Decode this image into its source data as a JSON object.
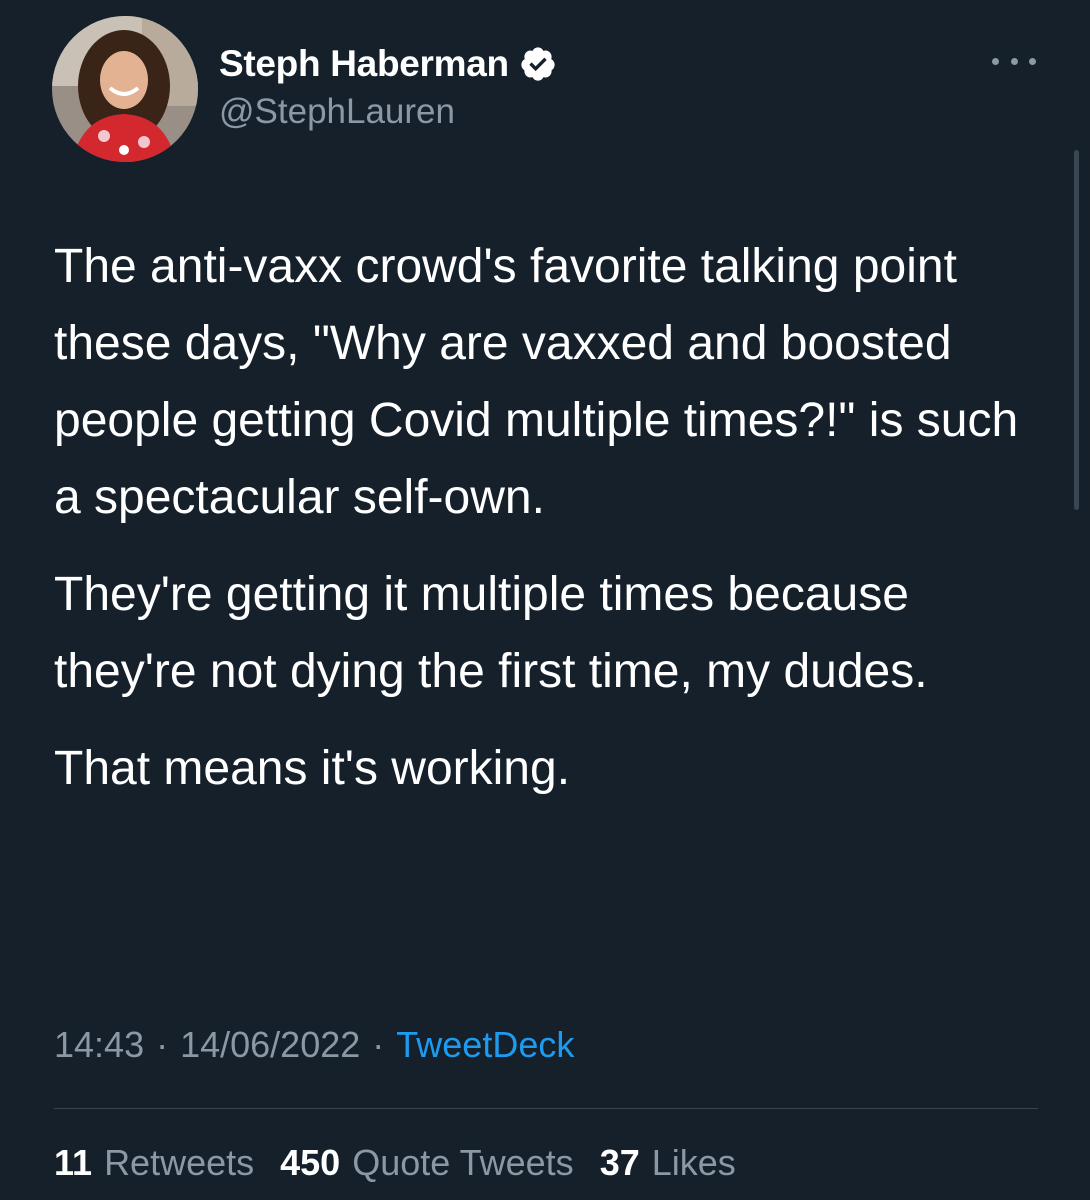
{
  "user": {
    "display_name": "Steph Haberman",
    "handle": "@StephLauren",
    "verified": true,
    "avatar_icon": "profile-photo"
  },
  "tweet": {
    "paragraphs": [
      "The anti-vaxx crowd's favorite talking point these days, \"Why are vaxxed and boosted people getting Covid multiple times?!\" is such a spectacular self-own.",
      "They're getting it multiple times because they're not dying the first time, my dudes.",
      "That means it's working."
    ],
    "time": "14:43",
    "date": "14/06/2022",
    "separator": "·",
    "source": "TweetDeck"
  },
  "stats": {
    "retweets_count": "11",
    "retweets_label": "Retweets",
    "quotes_count": "450",
    "quotes_label": "Quote Tweets",
    "likes_count": "37",
    "likes_label": "Likes"
  },
  "colors": {
    "background": "#15202b",
    "text": "#ffffff",
    "muted": "#8b98a5",
    "accent": "#1d9bf0",
    "divider": "#38444d"
  }
}
